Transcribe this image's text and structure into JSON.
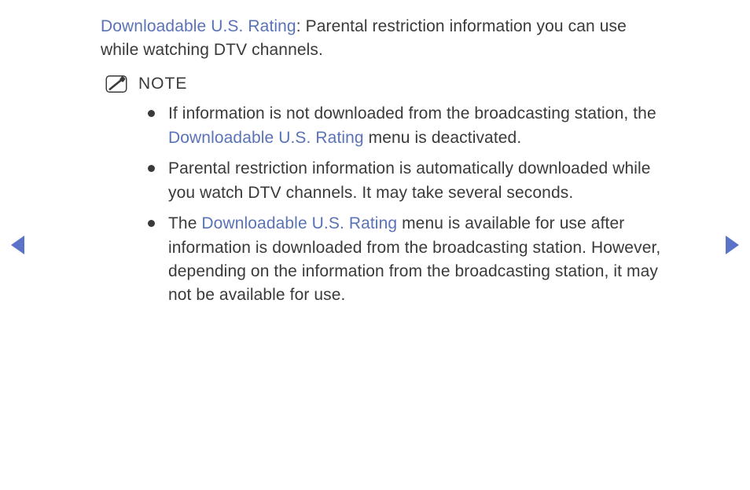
{
  "intro": {
    "title": "Downloadable U.S. Rating",
    "separator": ": ",
    "body": "Parental restriction information you can use while watching DTV channels."
  },
  "note": {
    "label": "NOTE"
  },
  "bullets": [
    {
      "pre": "If information is not downloaded from the broadcasting station, the ",
      "link": "Downloadable U.S. Rating",
      "post": " menu is deactivated."
    },
    {
      "pre": "Parental restriction information is automatically downloaded while you watch DTV channels. It may take several seconds.",
      "link": "",
      "post": ""
    },
    {
      "pre": "The ",
      "link": "Downloadable U.S. Rating",
      "post": " menu is available for use after information is downloaded from the broadcasting station. However, depending on the information from the broadcasting station, it may not be available for use."
    }
  ]
}
